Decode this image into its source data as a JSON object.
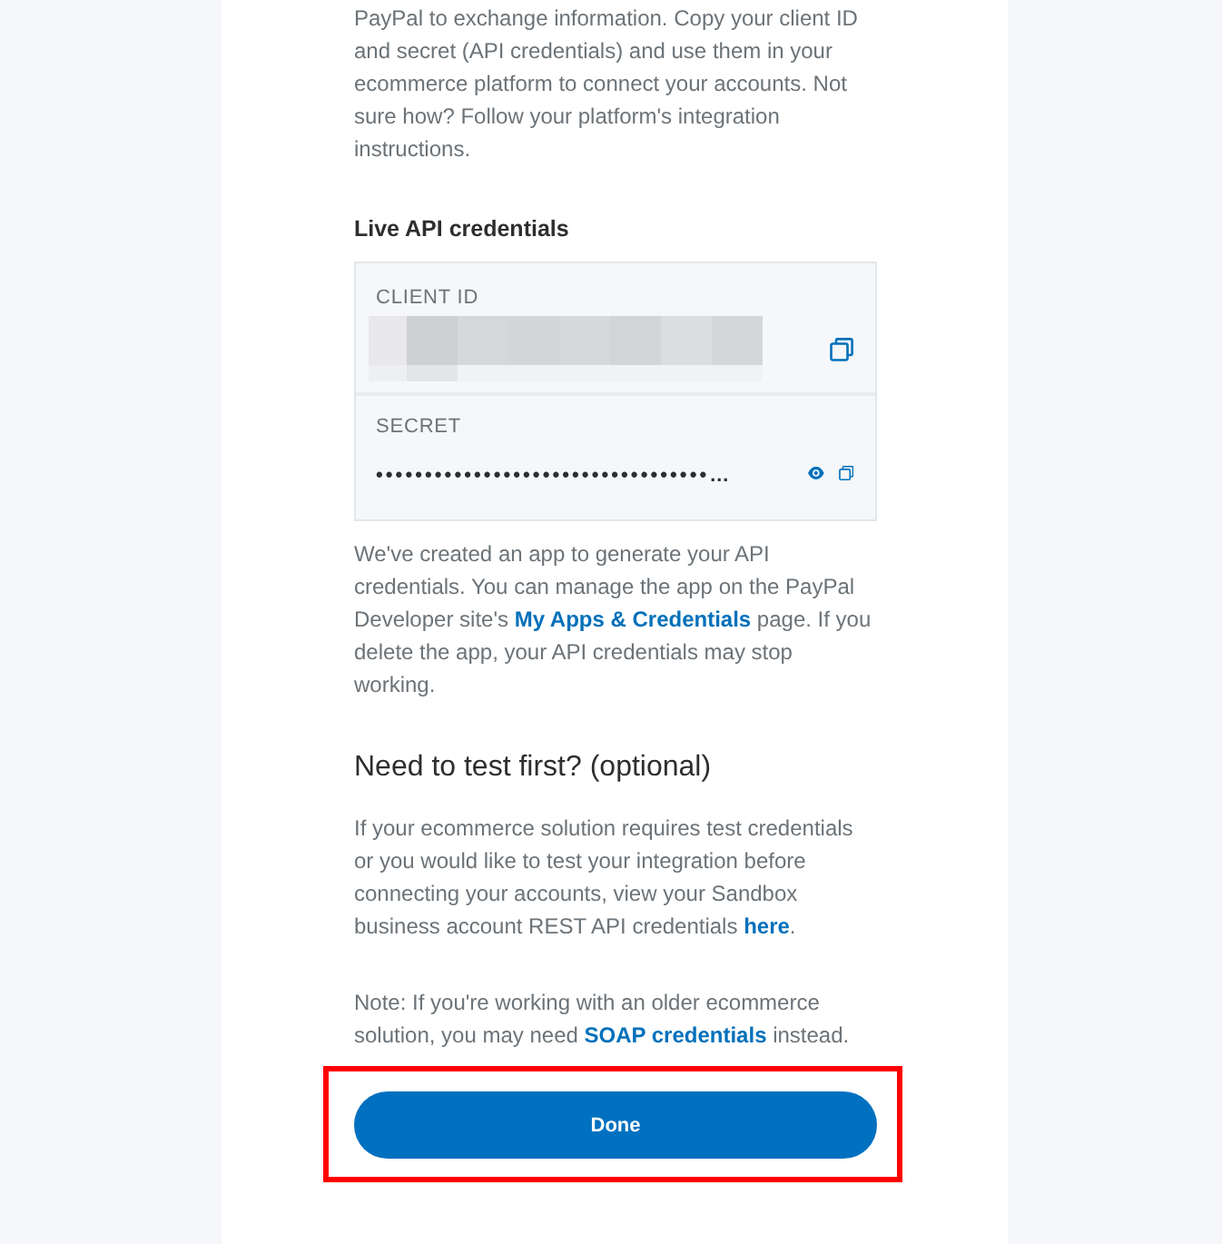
{
  "intro": [
    {
      "text": "PayPal to exchange information. Copy your client ID and secret (API credentials) and use them in your ecommerce platform to connect your accounts. Not sure how? Follow your platform's integration instructions."
    }
  ],
  "live_credentials": {
    "title": "Live API credentials",
    "fields": [
      {
        "kind": "redacted",
        "label": "CLIENT ID"
      },
      {
        "kind": "masked",
        "label": "SECRET",
        "value": "••••••••••••••••••••••••••••••••••…"
      }
    ]
  },
  "app_note": [
    {
      "text": "We've created an app to generate your API credentials. You can manage the app on the PayPal Developer site's "
    },
    {
      "link": "My Apps & Credentials"
    },
    {
      "text": " page. If you delete the app, your API credentials may stop working."
    }
  ],
  "test_section": {
    "title": "Need to test first? (optional)",
    "paragraph": [
      {
        "text": "If your ecommerce solution requires test credentials or you would like to test your integration before connecting your accounts, view your Sandbox business account REST API credentials "
      },
      {
        "link": "here"
      },
      {
        "text": "."
      }
    ],
    "note": [
      {
        "text": "Note: If you're working with an older ecommerce solution, you may need "
      },
      {
        "link": "SOAP credentials"
      },
      {
        "text": " instead."
      }
    ]
  },
  "done_button": {
    "label": "Done",
    "highlighted": true
  }
}
